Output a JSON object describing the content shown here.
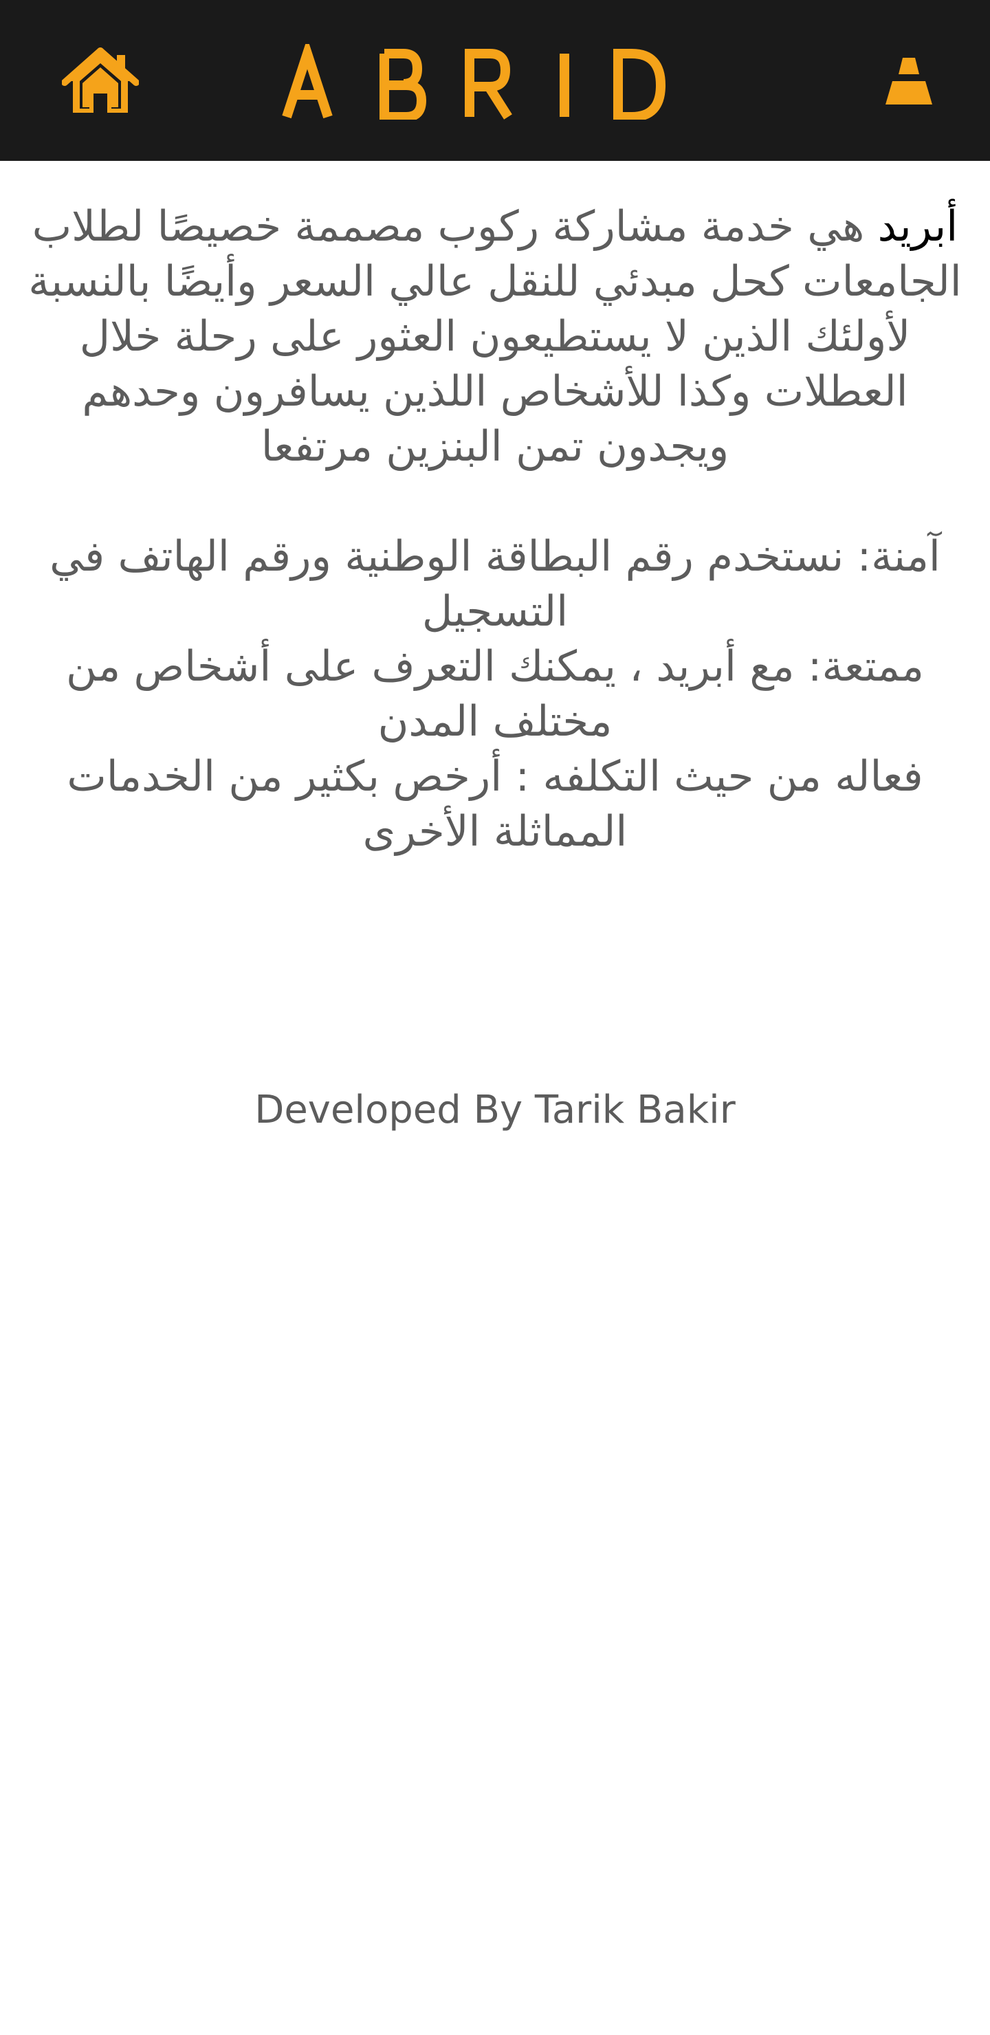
{
  "header": {
    "brand": "A B R I D",
    "home_icon": "home-icon",
    "user_icon": "user-icon",
    "accent_color": "#f5a31a",
    "background_color": "#1a1a1a"
  },
  "intro": {
    "brand_word": "أبريد",
    "text": "هي خدمة مشاركة ركوب مصممة خصيصًا لطلاب الجامعات كحل مبدئي للنقل عالي السعر وأيضًا بالنسبة لأولئك الذين لا يستطيعون العثور على رحلة خلال العطلات وكذا للأشخاص اللذين يسافرون وحدهم ويجدون تمن البنزين مرتفعا"
  },
  "features": [
    "آمنة: نستخدم رقم البطاقة الوطنية ورقم الهاتف في التسجيل",
    "ممتعة: مع أبريد ، يمكنك التعرف على أشخاص من مختلف المدن",
    "فعاله من حيث التكلفه : أرخص بكثير من الخدمات المماثلة الأخرى"
  ],
  "footer": {
    "credit": "Developed By Tarik Bakir"
  }
}
